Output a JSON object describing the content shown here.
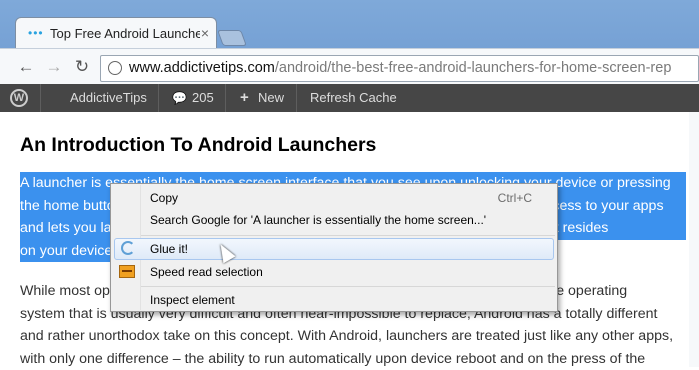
{
  "browser": {
    "tab_title": "Top Free Android Launcher",
    "tab_icon": "•••",
    "close_glyph": "×",
    "url_host": "www.addictivetips.com",
    "url_path": "/android/the-best-free-android-launchers-for-home-screen-rep"
  },
  "adminbar": {
    "site_name": "AddictiveTips",
    "comments_count": "205",
    "new_label": "New",
    "refresh_label": "Refresh Cache"
  },
  "article": {
    "title": "An Introduction To Android Launchers",
    "highlighted_lines": [
      "A launcher is essentially the home screen interface that you see upon unlocking your device or pressing",
      "the home button. It is the place where you get your app drawer, widgets and quick access to your apps",
      "and lets you launch them and switch between them or do just about anything else that resides",
      "on your device."
    ],
    "paragraph2_lines": [
      "While most operating systems come with their own launcher that is a built-in part of the operating",
      "system that is usually very difficult and often near-impossible to replace, Android has a totally different",
      "and rather unorthodox take on this concept. With Android, launchers are treated just like any other apps,",
      "with only one difference – the ability to run automatically upon device reboot and on the press of the"
    ]
  },
  "context_menu": {
    "items": [
      {
        "label": "Copy",
        "accel": "Ctrl+C"
      },
      {
        "label": "Search Google for 'A launcher is essentially the home screen...'"
      },
      {
        "label": "Glue it!",
        "icon": "glue-icon"
      },
      {
        "label": "Speed read selection",
        "icon": "speed-read-icon"
      },
      {
        "label": "Inspect element"
      }
    ]
  }
}
